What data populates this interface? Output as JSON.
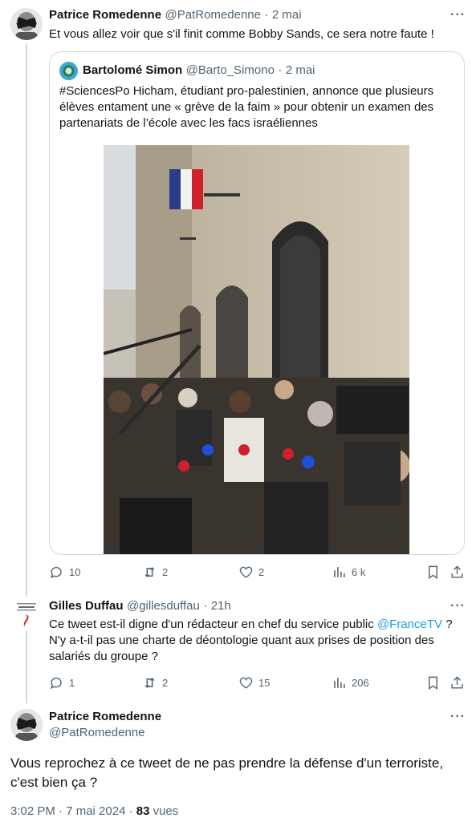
{
  "tweet1": {
    "author_name": "Patrice Romedenne",
    "author_handle": "@PatRomedenne",
    "sep": "·",
    "time": "2 mai",
    "text": "Et vous allez voir que s'il finit comme Bobby Sands, ce sera notre faute !",
    "quote": {
      "author_name": "Bartolomé Simon",
      "author_handle": "@Barto_Simono",
      "sep": "·",
      "time": "2 mai",
      "text": "#SciencesPo Hicham, étudiant pro-palestinien, annonce que plusieurs élèves entament une « grève de la faim » pour obtenir un examen des partenariats de l’école avec les facs israéliennes"
    },
    "stats": {
      "replies": "10",
      "retweets": "2",
      "likes": "2",
      "views": "6 k"
    }
  },
  "tweet2": {
    "author_name": "Gilles Duffau",
    "author_handle": "@gillesduffau",
    "sep": "·",
    "time": "21h",
    "text_before": "Ce tweet est-il digne d'un rédacteur en chef du service public ",
    "mention": "@FranceTV",
    "text_after": " ? N'y a-t-il pas une charte de déontologie quant aux prises de position des salariés du groupe ?",
    "stats": {
      "replies": "1",
      "retweets": "2",
      "likes": "15",
      "views": "206"
    }
  },
  "tweet3": {
    "author_name": "Patrice Romedenne",
    "author_handle": "@PatRomedenne",
    "text": "Vous reprochez à ce tweet de ne pas prendre la défense d'un terroriste, c'est bien ça ?",
    "timestamp": "3:02 PM · 7 mai 2024 · ",
    "views_count": "83",
    "views_label": " vues"
  },
  "more_glyph": "···"
}
